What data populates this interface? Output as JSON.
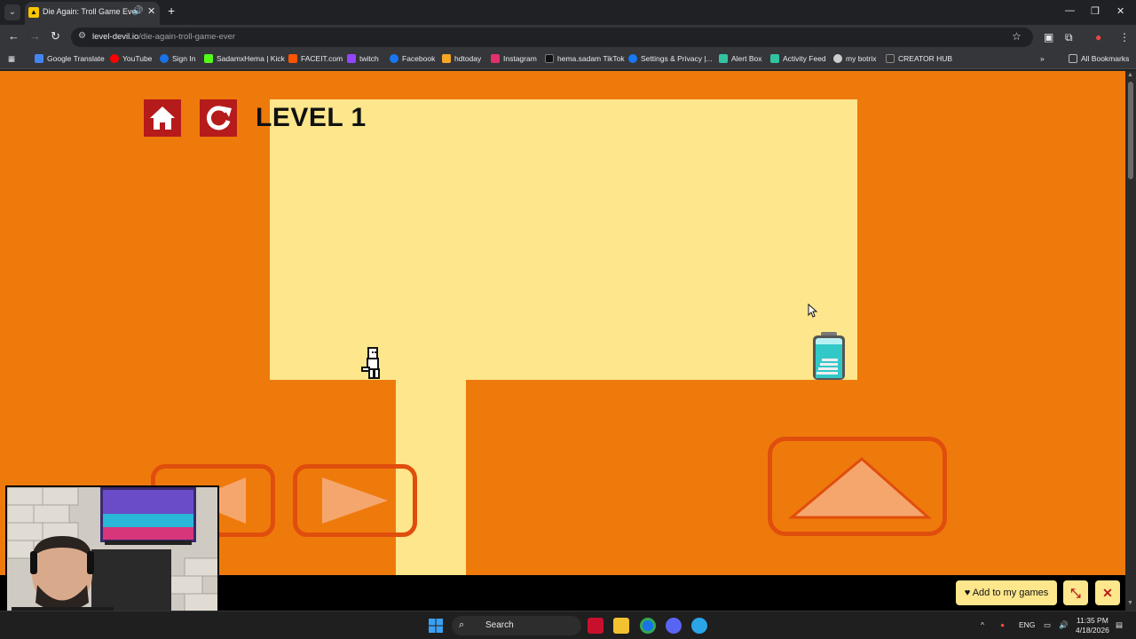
{
  "browser": {
    "tab_title": "Die Again: Troll Game Ever",
    "url_domain": "level-devil.io",
    "url_path": "/die-again-troll-game-ever",
    "all_bookmarks_label": "All Bookmarks"
  },
  "bookmarks": [
    {
      "label": "Google Translate",
      "icon": "translate-icon",
      "color": "#4285f4"
    },
    {
      "label": "YouTube",
      "icon": "youtube-icon",
      "color": "#ff0000"
    },
    {
      "label": "Sign In",
      "icon": "signin-icon",
      "color": "#1a73e8"
    },
    {
      "label": "SadamxHema | Kick",
      "icon": "kick-icon",
      "color": "#53fc18"
    },
    {
      "label": "FACEIT.com",
      "icon": "faceit-icon",
      "color": "#ff5500"
    },
    {
      "label": "twitch",
      "icon": "twitch-icon",
      "color": "#9146ff"
    },
    {
      "label": "Facebook",
      "icon": "facebook-icon",
      "color": "#1877f2"
    },
    {
      "label": "hdtoday",
      "icon": "hdtoday-icon",
      "color": "#f5a623"
    },
    {
      "label": "Instagram",
      "icon": "instagram-icon",
      "color": "#e1306c"
    },
    {
      "label": "hema.sadam TikTok",
      "icon": "tiktok-icon",
      "color": "#111111"
    },
    {
      "label": "Settings & Privacy |...",
      "icon": "facebook-icon",
      "color": "#1877f2"
    },
    {
      "label": "Alert Box",
      "icon": "alertbox-icon",
      "color": "#31c3a2"
    },
    {
      "label": "Activity Feed",
      "icon": "activity-icon",
      "color": "#31c3a2"
    },
    {
      "label": "my botrix",
      "icon": "botrix-icon",
      "color": "#cccccc"
    },
    {
      "label": "CREATOR HUB",
      "icon": "creatorhub-icon",
      "color": "#333333"
    }
  ],
  "game": {
    "level_title": "LEVEL 1",
    "colors": {
      "background": "#ef7a0c",
      "room": "#fde68b",
      "button": "#b51b1b",
      "control_border": "#e04e0d",
      "control_fill": "#f5a66d"
    }
  },
  "site_bar": {
    "add_to_games": "Add to my games"
  },
  "taskbar": {
    "search_placeholder": "Search",
    "language": "ENG",
    "time": "11:35 PM",
    "date": "4/18/2026"
  }
}
